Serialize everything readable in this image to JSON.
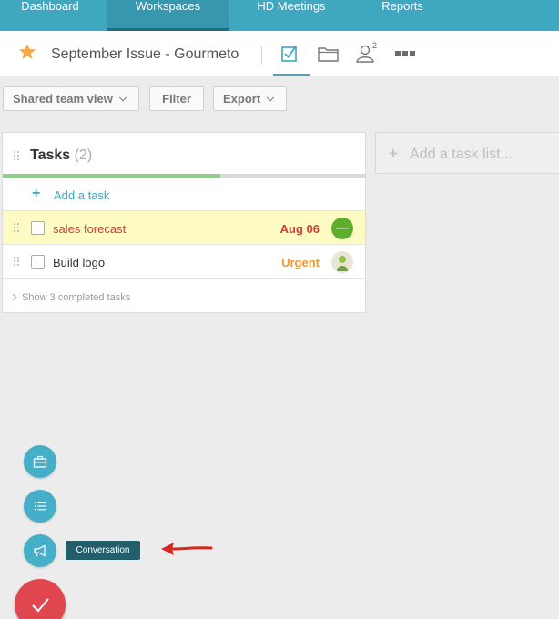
{
  "nav": {
    "items": [
      {
        "label": "Dashboard",
        "active": false
      },
      {
        "label": "Workspaces",
        "active": true
      },
      {
        "label": "HD Meetings",
        "active": false
      },
      {
        "label": "Reports",
        "active": false
      }
    ]
  },
  "project": {
    "title": "September Issue - Gourmeto",
    "members_count": "2",
    "tools": [
      "tasks-icon",
      "folder-icon",
      "members-icon",
      "more-icon"
    ]
  },
  "toolbar": {
    "view_label": "Shared team view",
    "filter_label": "Filter",
    "export_label": "Export"
  },
  "tasklist": {
    "title": "Tasks",
    "count": "(2)",
    "progress_fraction": 0.6,
    "add_task_label": "Add a task",
    "tasks": [
      {
        "name": "sales forecast",
        "meta": "Aug 06",
        "highlighted": true,
        "name_color": "#d7393f",
        "meta_color": "#d7393f",
        "avatar_color": "#5cae2c"
      },
      {
        "name": "Build logo",
        "meta": "Urgent",
        "highlighted": false,
        "name_color": "#333333",
        "meta_color": "#e69a35",
        "avatar_color": "#8fc14a"
      }
    ],
    "show_completed_label": "Show 3 completed tasks"
  },
  "add_list": {
    "placeholder": "Add a task list..."
  },
  "fab": {
    "buttons": [
      "briefcase-icon",
      "list-icon",
      "megaphone-icon"
    ],
    "tooltip": "Conversation",
    "main_icon": "checkmark-icon"
  },
  "colors": {
    "accent": "#3fa7c0",
    "danger": "#e0464d",
    "highlight_row": "#fdfbc2"
  }
}
